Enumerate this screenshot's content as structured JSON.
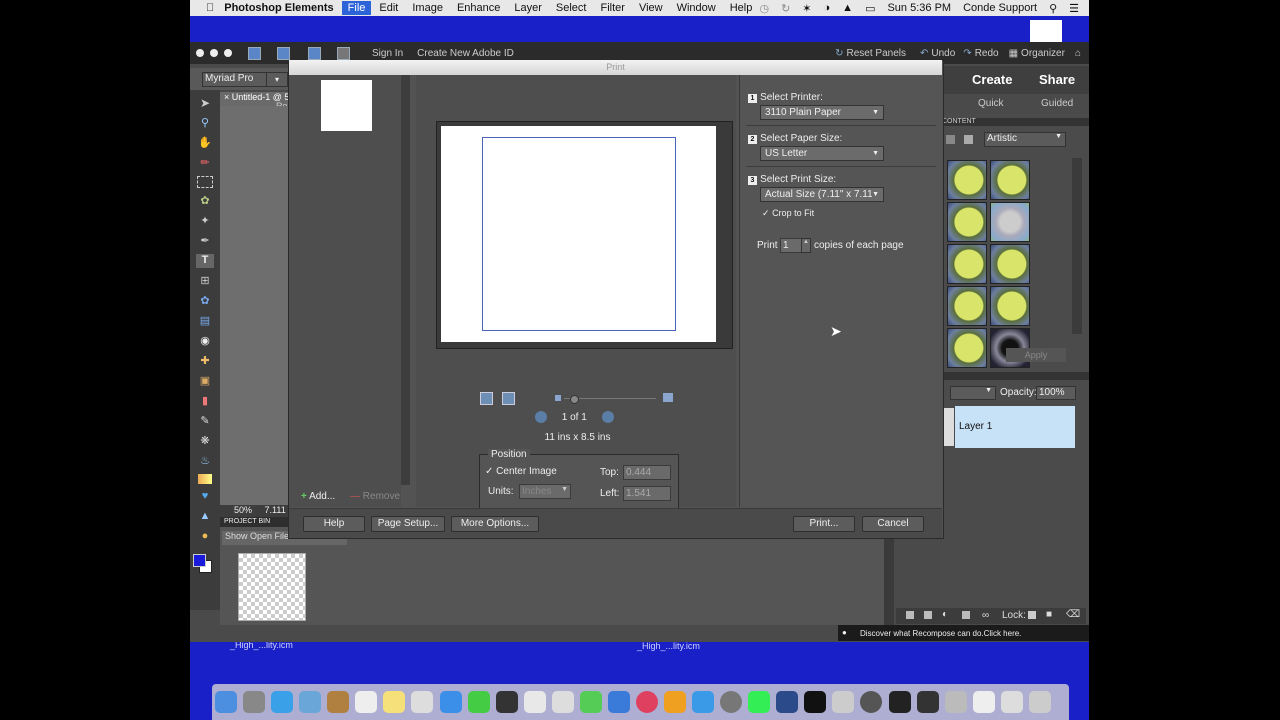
{
  "menubar": {
    "app": "Photoshop Elements",
    "items": [
      "File",
      "Edit",
      "Image",
      "Enhance",
      "Layer",
      "Select",
      "Filter",
      "View",
      "Window",
      "Help"
    ],
    "clock": "Sun 5:36 PM",
    "user": "Conde Support"
  },
  "pse_top": {
    "sign_in": "Sign In",
    "create_id": "Create New Adobe ID",
    "reset_panels": "Reset Panels",
    "undo": "Undo",
    "redo": "Redo",
    "organizer": "Organizer"
  },
  "options_bar": {
    "font": "Myriad Pro"
  },
  "document": {
    "tab": "Untitled-1 @ 5",
    "tab2": "Re",
    "zoom": "50%",
    "status": "7.111"
  },
  "project_bin": {
    "header": "PROJECT BIN",
    "select": "Show Open Files"
  },
  "right_panel": {
    "create": "Create",
    "share": "Share",
    "quick": "Quick",
    "guided": "Guided",
    "content_header": "CONTENT",
    "filter_value": "Artistic",
    "apply": "Apply",
    "opacity_label": "Opacity:",
    "opacity_value": "100%",
    "layer_name": "Layer 1",
    "lock_label": "Lock:",
    "tip": "Discover what Recompose can do.Click here."
  },
  "desktop_labels": [
    "_High_...lity.icm",
    "_High_...lity.icm"
  ],
  "print_dialog": {
    "title": "Print",
    "add": "Add...",
    "remove": "Remove",
    "pager": "1 of 1",
    "dimensions": "11 ins x 8.5 ins",
    "position": {
      "label": "Position",
      "center_image": "Center Image",
      "units_label": "Units:",
      "units_value": "Inches",
      "top_label": "Top:",
      "top_value": "0.444",
      "left_label": "Left:",
      "left_value": "1.541"
    },
    "steps": [
      {
        "num": "1",
        "title": "Select Printer:",
        "value": "3110 Plain Paper"
      },
      {
        "num": "2",
        "title": "Select Paper Size:",
        "value": "US Letter"
      },
      {
        "num": "3",
        "title": "Select Print Size:",
        "value": "Actual Size (7.11\" x 7.11"
      }
    ],
    "crop_to_fit": "Crop to Fit",
    "print_label": "Print",
    "copies": "1",
    "copies_suffix": "copies of each page",
    "buttons": {
      "help": "Help",
      "page_setup": "Page Setup...",
      "more_options": "More Options...",
      "print": "Print...",
      "cancel": "Cancel"
    }
  },
  "colors": {
    "desktop": "#1a20c8",
    "selected_menu": "#2d63d9",
    "layer_selected": "#c7e1f7"
  }
}
